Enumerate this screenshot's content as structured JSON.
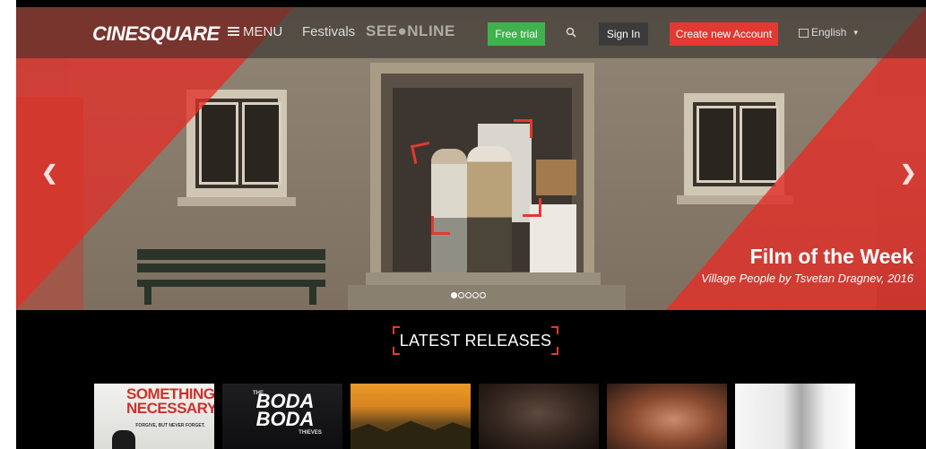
{
  "nav": {
    "logo": "CINESQUARE",
    "menu_label": "MENU",
    "festivals_label": "Festivals",
    "seeonline_label": "SEE●NLINE",
    "free_trial_label": "Free trial",
    "sign_in_label": "Sign In",
    "create_account_label": "Create new Account",
    "language_label": "English"
  },
  "hero": {
    "heading": "Film of the Week",
    "subtitle": "Village People by Tsvetan Dragnev, 2016",
    "slide_count": 5,
    "active_slide": 1
  },
  "latest": {
    "heading": "LATEST RELEASES",
    "posters": [
      {
        "text": "SOMETHING NECESSARY",
        "tagline": "FORGIVE, BUT NEVER FORGET."
      },
      {
        "text": "BODA BODA",
        "prefix": "THE",
        "suffix": "THIEVES"
      },
      {
        "text": ""
      },
      {
        "text": ""
      },
      {
        "text": ""
      },
      {
        "text": ""
      }
    ]
  },
  "colors": {
    "accent_red": "#e23a32",
    "trial_green": "#3fb24d",
    "signin_dark": "#3c3b3b"
  },
  "icons": [
    "menu-icon",
    "search-icon",
    "flag-icon",
    "chevron-down-icon",
    "chevron-left-icon",
    "chevron-right-icon"
  ]
}
